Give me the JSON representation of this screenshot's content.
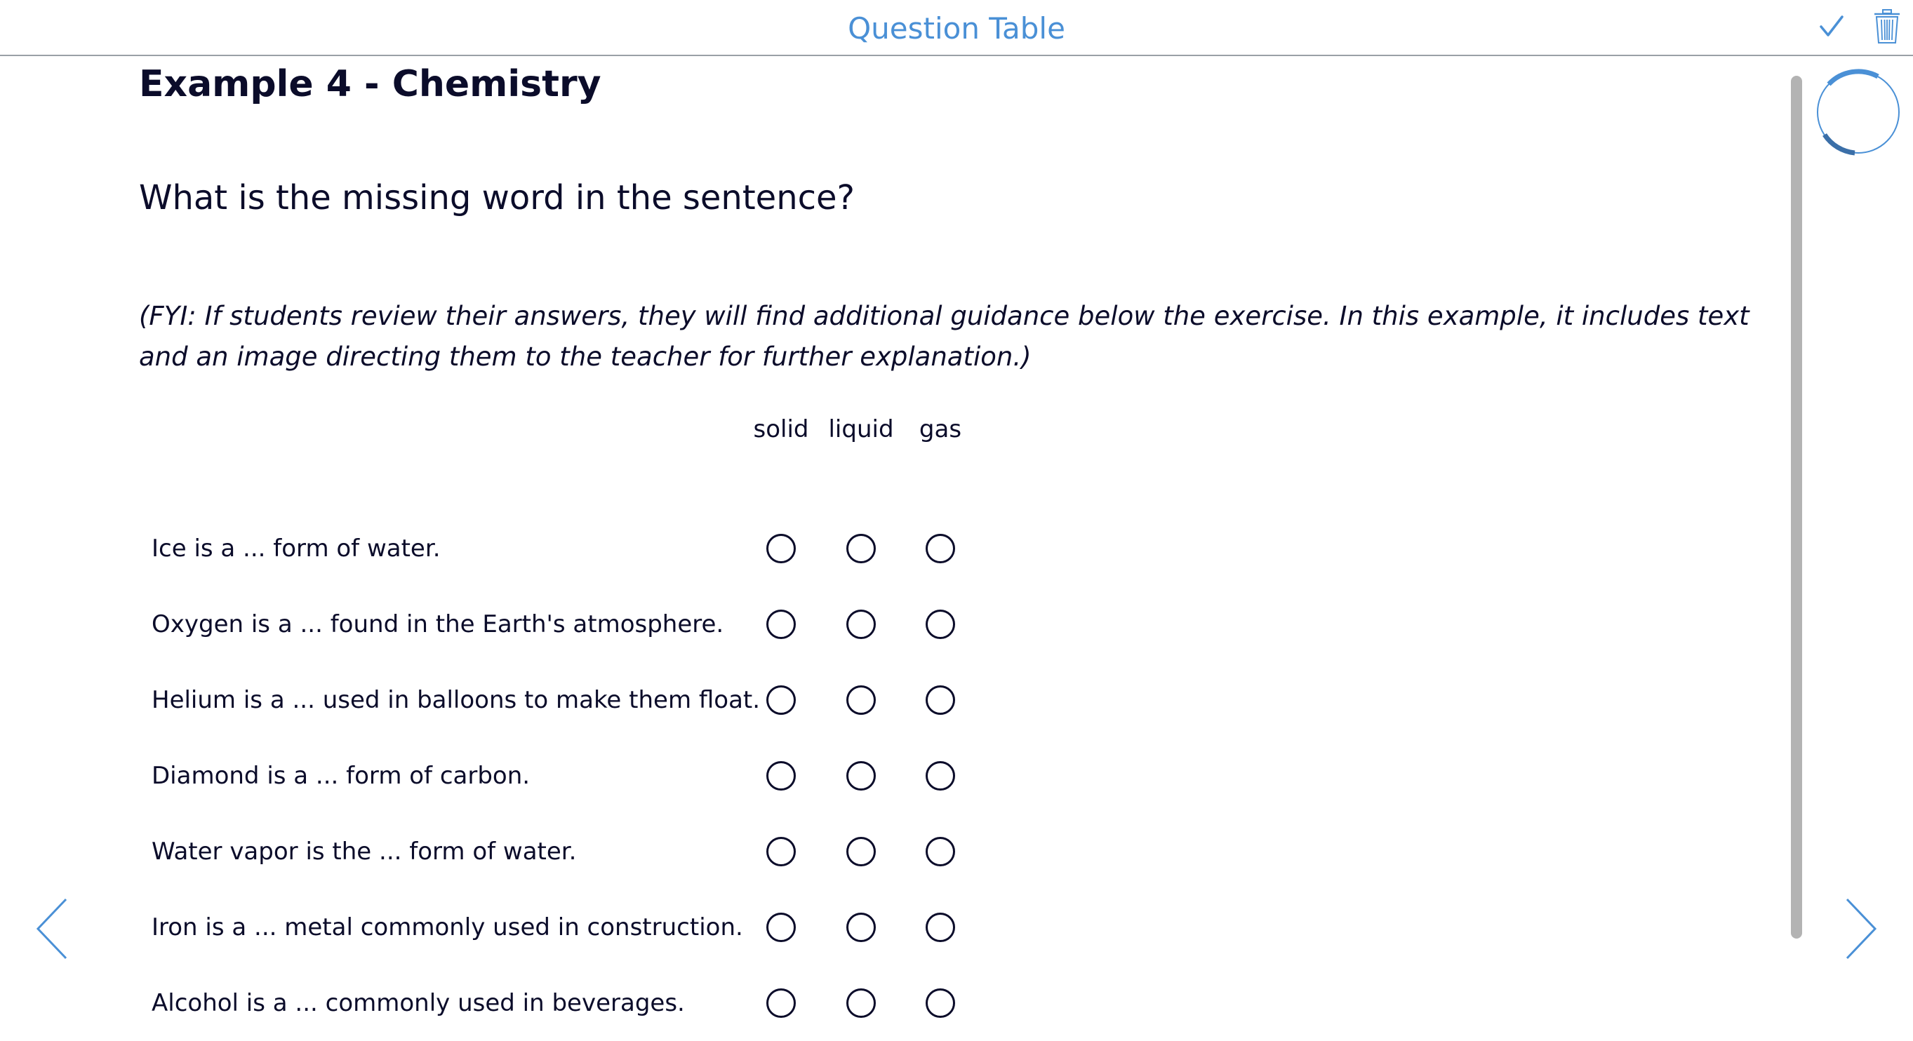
{
  "header": {
    "title": "Question Table"
  },
  "icons": {
    "check": "check-icon",
    "trash": "trash-icon",
    "prev": "chevron-left-icon",
    "next": "chevron-right-icon",
    "progress": "progress-ring"
  },
  "colors": {
    "accent": "#4a90d6",
    "accent_dark": "#3b6fa8",
    "text": "#0b0c2a",
    "scrollbar": "#b3b3b3"
  },
  "exercise": {
    "title": "Example 4 - Chemistry",
    "question": "What is the missing word in the sentence?",
    "fyi": "(FYI: If students review their answers, they will find additional guidance below the exercise. In this example, it includes text and an image directing them to the teacher for further explanation.)"
  },
  "table": {
    "columns": [
      "solid",
      "liquid",
      "gas"
    ],
    "rows": [
      {
        "label": "Ice is a ... form of water.",
        "selected": null
      },
      {
        "label": "Oxygen is a ... found in the Earth's atmosphere.",
        "selected": null
      },
      {
        "label": "Helium is a ... used in balloons to make them float.",
        "selected": null
      },
      {
        "label": "Diamond is a ... form of carbon.",
        "selected": null
      },
      {
        "label": "Water vapor is the ... form of water.",
        "selected": null
      },
      {
        "label": "Iron is a ... metal commonly used in construction.",
        "selected": null
      },
      {
        "label": "Alcohol is a ... commonly used in beverages.",
        "selected": null
      }
    ]
  }
}
